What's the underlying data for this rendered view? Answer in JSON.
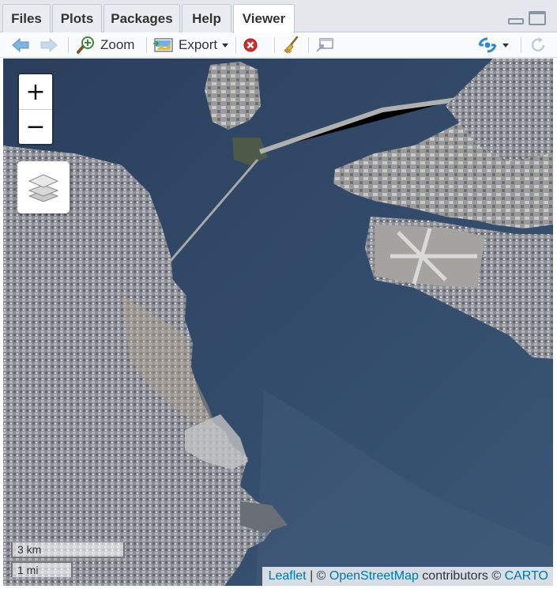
{
  "tabs": [
    {
      "label": "Files"
    },
    {
      "label": "Plots"
    },
    {
      "label": "Packages"
    },
    {
      "label": "Help"
    },
    {
      "label": "Viewer"
    }
  ],
  "active_tab": "Viewer",
  "toolbar": {
    "zoom_label": "Zoom",
    "export_label": "Export"
  },
  "map": {
    "zoom_in": "+",
    "zoom_out": "−",
    "scale_km": "3 km",
    "scale_mi": "1 mi",
    "attribution": {
      "leaflet": "Leaflet",
      "sep1": " | © ",
      "osm": "OpenStreetMap",
      "mid": " contributors © ",
      "carto": "CARTO"
    }
  },
  "colors": {
    "water": "#2f4563",
    "land": "#8a8a8a",
    "link": "#0078a8"
  }
}
